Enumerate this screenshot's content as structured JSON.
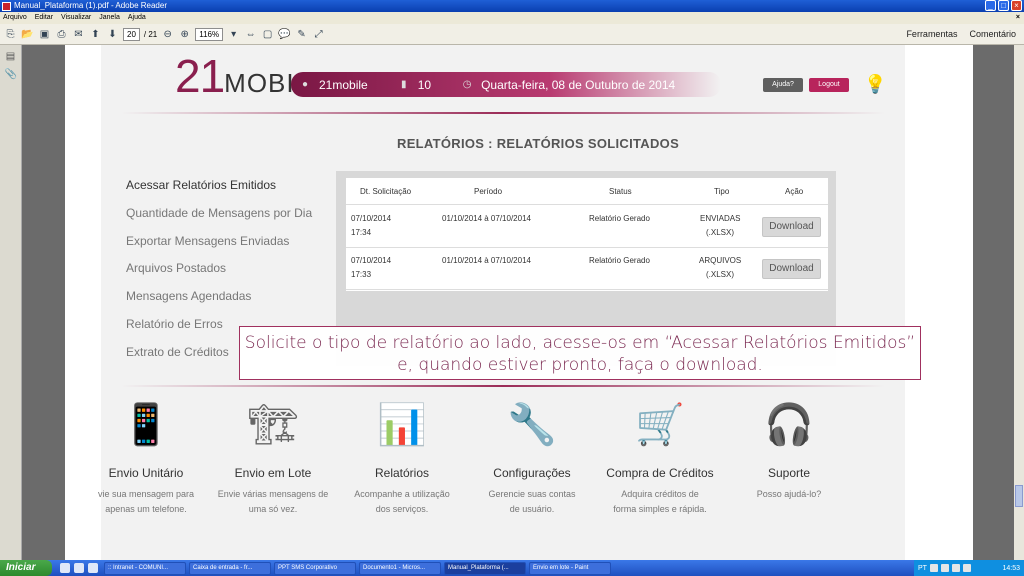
{
  "window": {
    "title": "Manual_Plataforma (1).pdf - Adobe Reader"
  },
  "menu": [
    "Arquivo",
    "Editar",
    "Visualizar",
    "Janela",
    "Ajuda"
  ],
  "toolbar": {
    "page_current": "20",
    "page_total": "/ 21",
    "zoom": "116%",
    "tools_label": "Ferramentas",
    "comment_label": "Comentário"
  },
  "header": {
    "logo_num": "21",
    "logo_rest": "MOBILE",
    "user": "21mobile",
    "credits": "10",
    "date": "Quarta-feira, 08 de Outubro de 2014",
    "help_button": "Ajuda?",
    "logout_button": "Logout"
  },
  "section_title": "RELATÓRIOS : RELATÓRIOS SOLICITADOS",
  "side_menu": [
    "Acessar Relatórios Emitidos",
    "Quantidade de Mensagens por Dia",
    "Exportar Mensagens Enviadas",
    "Arquivos Postados",
    "Mensagens Agendadas",
    "Relatório de Erros",
    "Extrato de Créditos"
  ],
  "table": {
    "headers": [
      "Dt. Solicitação",
      "Período",
      "Status",
      "Tipo",
      "Ação"
    ],
    "rows": [
      {
        "date": "07/10/2014",
        "time": "17:34",
        "period": "01/10/2014 à 07/10/2014",
        "status": "Relatório Gerado",
        "type": "ENVIADAS",
        "format": "(.XLSX)",
        "action": "Download"
      },
      {
        "date": "07/10/2014",
        "time": "17:33",
        "period": "01/10/2014 à 07/10/2014",
        "status": "Relatório Gerado",
        "type": "ARQUIVOS",
        "format": "(.XLSX)",
        "action": "Download"
      }
    ]
  },
  "callout": {
    "line1": "Solicite o tipo de relatório ao lado, acesse-os em “Acessar Relatórios Emitidos”",
    "line2": "e, quando estiver pronto, faça o download."
  },
  "features": [
    {
      "title": "Envio Unitário",
      "desc1": "vie sua mensagem para",
      "desc2": "apenas um telefone."
    },
    {
      "title": "Envio em Lote",
      "desc1": "Envie várias mensagens de",
      "desc2": "uma só vez."
    },
    {
      "title": "Relatórios",
      "desc1": "Acompanhe a utilização",
      "desc2": "dos serviços."
    },
    {
      "title": "Configurações",
      "desc1": "Gerencie suas contas",
      "desc2": "de usuário."
    },
    {
      "title": "Compra de Créditos",
      "desc1": "Adquira créditos de",
      "desc2": "forma simples e rápida."
    },
    {
      "title": "Suporte",
      "desc1": "Posso ajudá-lo?",
      "desc2": ""
    }
  ],
  "taskbar": {
    "start": "Iniciar",
    "tasks": [
      ":: Intranet - COMUNI...",
      "Caixa de entrada - fr...",
      "PPT SMS Corporativo",
      "Documento1 - Micros...",
      "Manual_Plataforma (...",
      "Envio em lote - Paint"
    ],
    "lang": "PT",
    "clock": "14:53"
  }
}
